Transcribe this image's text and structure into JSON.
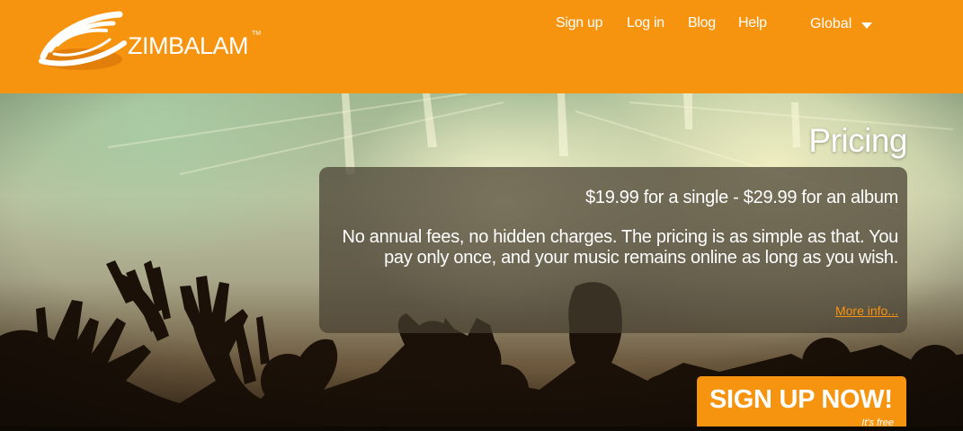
{
  "header": {
    "brand": "ZIMBALAM",
    "brand_tm": "TM",
    "nav": {
      "signup": "Sign up",
      "login": "Log in",
      "blog": "Blog",
      "help": "Help",
      "region": "Global"
    }
  },
  "hero": {
    "title": "Pricing",
    "price_line": "$19.99 for a single - $29.99 for an album",
    "description": "No annual fees, no hidden charges. The pricing is as simple as that. You pay only once, and your music remains online as long as you wish.",
    "more_info": "More info...",
    "cta": {
      "label": "SIGN UP NOW!",
      "sub": "It's free"
    }
  },
  "colors": {
    "brand_orange": "#f7940f",
    "overlay": "#463e30"
  },
  "icons": {
    "logo": "zimbalam-swirl-logo",
    "dropdown": "caret-down-icon"
  }
}
